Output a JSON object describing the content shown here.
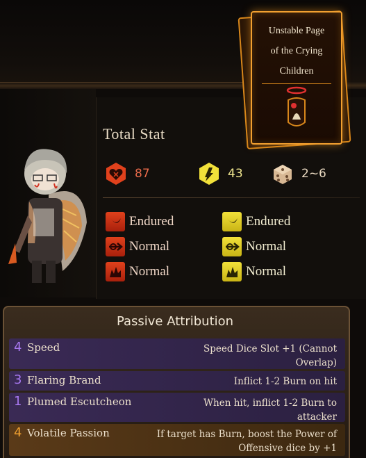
{
  "key_page": {
    "title_line1": "Unstable Page",
    "title_line2": "of the Crying",
    "title_line3": "Children"
  },
  "total_stat": {
    "label": "Total Stat",
    "hp": "87",
    "stagger": "43",
    "speed": "2~6"
  },
  "resistances": {
    "hp": [
      "Endured",
      "Normal",
      "Normal"
    ],
    "stagger": [
      "Endured",
      "Normal",
      "Normal"
    ]
  },
  "passive": {
    "header": "Passive Attribution",
    "items": [
      {
        "cost": "4",
        "name": "Speed",
        "desc": "Speed Dice Slot +1 (Cannot Overlap)",
        "tier": "purple"
      },
      {
        "cost": "3",
        "name": "Flaring Brand",
        "desc": "Inflict 1-2 Burn on hit",
        "tier": "purple"
      },
      {
        "cost": "1",
        "name": "Plumed Escutcheon",
        "desc": "When hit, inflict 1-2 Burn to attacker",
        "tier": "purple"
      },
      {
        "cost": "4",
        "name": "Volatile Passion",
        "desc": "If target has Burn, boost the Power of Offensive dice by +1",
        "tier": "orange"
      }
    ]
  },
  "colors": {
    "hp_red": "#e0411c",
    "stagger_yellow": "#f2e13a",
    "page_orange": "#f2a030",
    "passive_purple": "#3a2a55",
    "passive_orange": "#5a3a18"
  }
}
